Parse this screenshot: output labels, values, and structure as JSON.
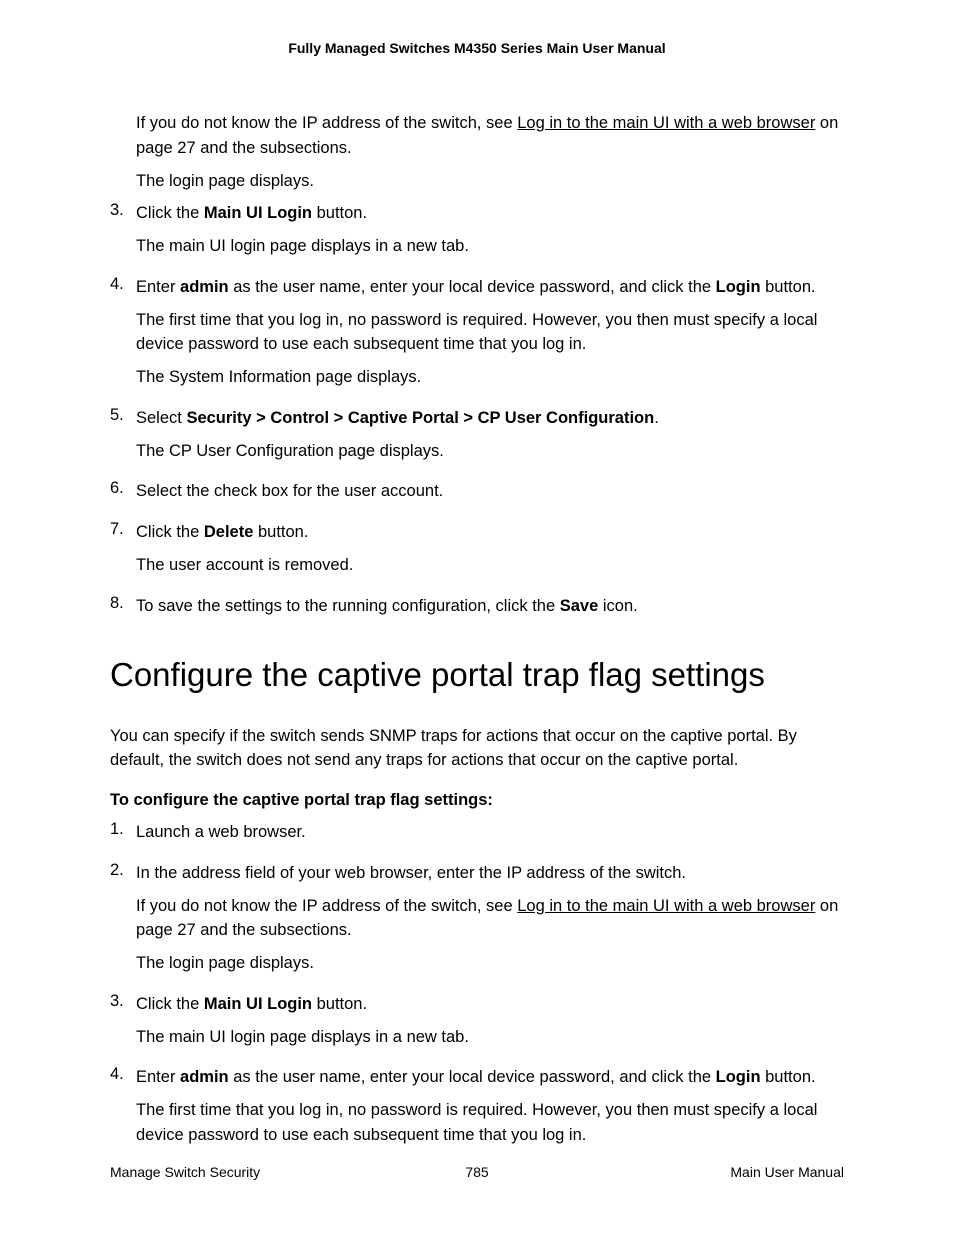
{
  "header": {
    "title": "Fully Managed Switches M4350 Series Main User Manual"
  },
  "content": {
    "p1_pre": "If you do not know the IP address of the switch, see ",
    "p1_link": "Log in to the main UI with a web browser",
    "p1_post": " on page 27 and the subsections.",
    "p2": "The login page displays.",
    "step3_num": "3.",
    "step3_pre": "Click the ",
    "step3_bold": "Main UI Login",
    "step3_post": " button.",
    "step3_p2": "The main UI login page displays in a new tab.",
    "step4_num": "4.",
    "step4_pre": "Enter ",
    "step4_bold1": "admin",
    "step4_mid": " as the user name, enter your local device password, and click the ",
    "step4_bold2": "Login",
    "step4_post": " button.",
    "step4_p2": "The first time that you log in, no password is required. However, you then must specify a local device password to use each subsequent time that you log in.",
    "step4_p3": "The System Information page displays.",
    "step5_num": "5.",
    "step5_pre": "Select ",
    "step5_bold": "Security > Control > Captive Portal > CP User Configuration",
    "step5_post": ".",
    "step5_p2": "The CP User Configuration page displays.",
    "step6_num": "6.",
    "step6_text": "Select the check box for the user account.",
    "step7_num": "7.",
    "step7_pre": "Click the ",
    "step7_bold": "Delete",
    "step7_post": " button.",
    "step7_p2": "The user account is removed.",
    "step8_num": "8.",
    "step8_pre": "To save the settings to the running configuration, click the ",
    "step8_bold": "Save",
    "step8_post": " icon.",
    "section_heading": "Configure the captive portal trap flag settings",
    "section_intro": "You can specify if the switch sends SNMP traps for actions that occur on the captive portal. By default, the switch does not send any traps for actions that occur on the captive portal.",
    "sub_heading": "To configure the captive portal trap flag settings:",
    "b_step1_num": "1.",
    "b_step1_text": "Launch a web browser.",
    "b_step2_num": "2.",
    "b_step2_text": "In the address field of your web browser, enter the IP address of the switch.",
    "b_step2_p2_pre": "If you do not know the IP address of the switch, see ",
    "b_step2_p2_link": "Log in to the main UI with a web browser",
    "b_step2_p2_post": " on page 27 and the subsections.",
    "b_step2_p3": "The login page displays.",
    "b_step3_num": "3.",
    "b_step3_pre": "Click the ",
    "b_step3_bold": "Main UI Login",
    "b_step3_post": " button.",
    "b_step3_p2": "The main UI login page displays in a new tab.",
    "b_step4_num": "4.",
    "b_step4_pre": "Enter ",
    "b_step4_bold1": "admin",
    "b_step4_mid": " as the user name, enter your local device password, and click the ",
    "b_step4_bold2": "Login",
    "b_step4_post": " button.",
    "b_step4_p2": "The first time that you log in, no password is required. However, you then must specify a local device password to use each subsequent time that you log in."
  },
  "footer": {
    "left": "Manage Switch Security",
    "center": "785",
    "right": "Main User Manual"
  }
}
